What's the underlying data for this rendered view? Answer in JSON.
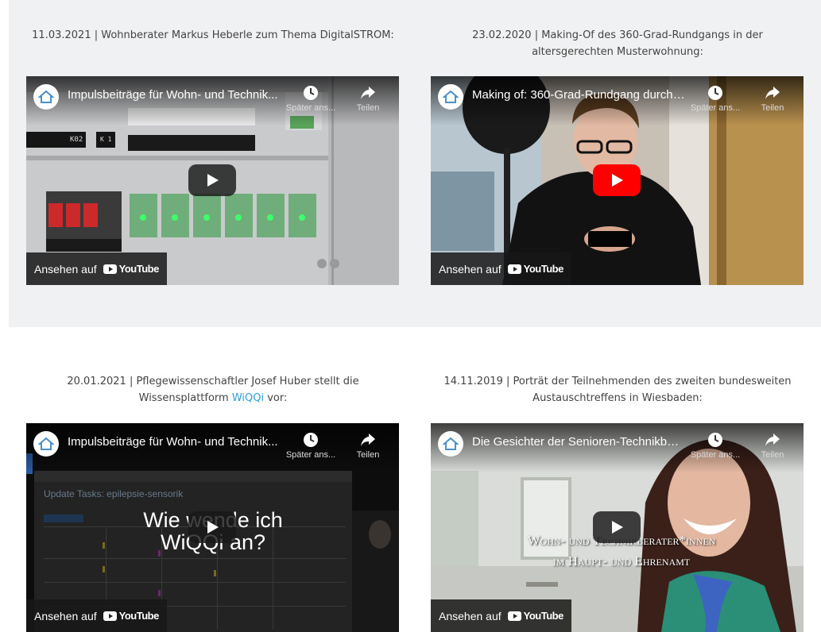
{
  "videos": [
    {
      "caption": "11.03.2021 | Wohnberater Markus Heberle zum Thema DigitalSTROM:",
      "title": "Impulsbeiträge für Wohn- und Technik...",
      "watch_later": "Später ans...",
      "share": "Teilen",
      "watch_on": "Ansehen auf",
      "youtube": "YouTube",
      "panel_label_1": "K02",
      "panel_label_2": "K 1"
    },
    {
      "caption": "23.02.2020 | Making-Of des 360-Grad-Rundgangs in der altersgerechten Musterwohnung:",
      "title": "Making of: 360-Grad-Rundgang durch ...",
      "watch_later": "Später ans...",
      "share": "Teilen",
      "watch_on": "Ansehen auf",
      "youtube": "YouTube"
    },
    {
      "caption_prefix": "20.01.2021 | Pflegewissenschaftler Josef Huber stellt die Wissensplattform ",
      "caption_link": "WiQQi",
      "caption_suffix": " vor:",
      "title": "Impulsbeiträge für Wohn- und Technik...",
      "watch_later": "Später ans...",
      "share": "Teilen",
      "watch_on": "Ansehen auf",
      "youtube": "YouTube",
      "overlay_line1": "Wie wende ich",
      "overlay_line2": "WiQQi an?",
      "screen_heading": "Update Tasks: epilepsie-sensorik"
    },
    {
      "caption": "14.11.2019 | Porträt der Teilnehmenden des zweiten bundesweiten Austauschtreffens in Wiesbaden:",
      "title": "Die Gesichter der Senioren-Technikber...",
      "watch_later": "Später ans...",
      "share": "Teilen",
      "watch_on": "Ansehen auf",
      "youtube": "YouTube",
      "overlay_line1": "Wohn- und Technikberater*innen",
      "overlay_line2": "im Haupt- und Ehrenamt"
    }
  ],
  "colors": {
    "band": "#f0f1f2",
    "caption_text": "#444444",
    "link": "#2a9fd6",
    "youtube_red": "#ff0000"
  }
}
